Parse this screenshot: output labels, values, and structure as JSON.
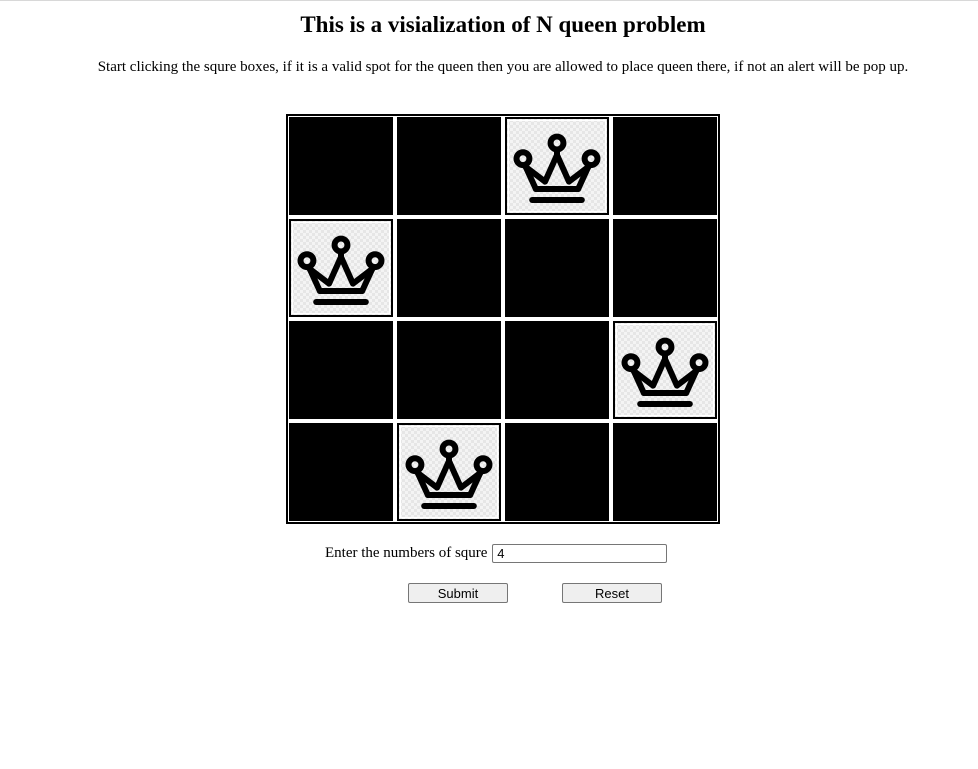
{
  "page": {
    "title": "This is a visialization of N queen problem",
    "instructions": "Start clicking the squre boxes, if it is a valid spot for the queen then you are allowed to place queen there, if not an alert will be pop up."
  },
  "board": {
    "size": 4,
    "queens": [
      {
        "row": 0,
        "col": 2
      },
      {
        "row": 1,
        "col": 0
      },
      {
        "row": 2,
        "col": 3
      },
      {
        "row": 3,
        "col": 1
      }
    ],
    "queen_icon": "crown-icon"
  },
  "form": {
    "label": "Enter the numbers of squre",
    "value": "4",
    "submit_label": "Submit",
    "reset_label": "Reset"
  }
}
